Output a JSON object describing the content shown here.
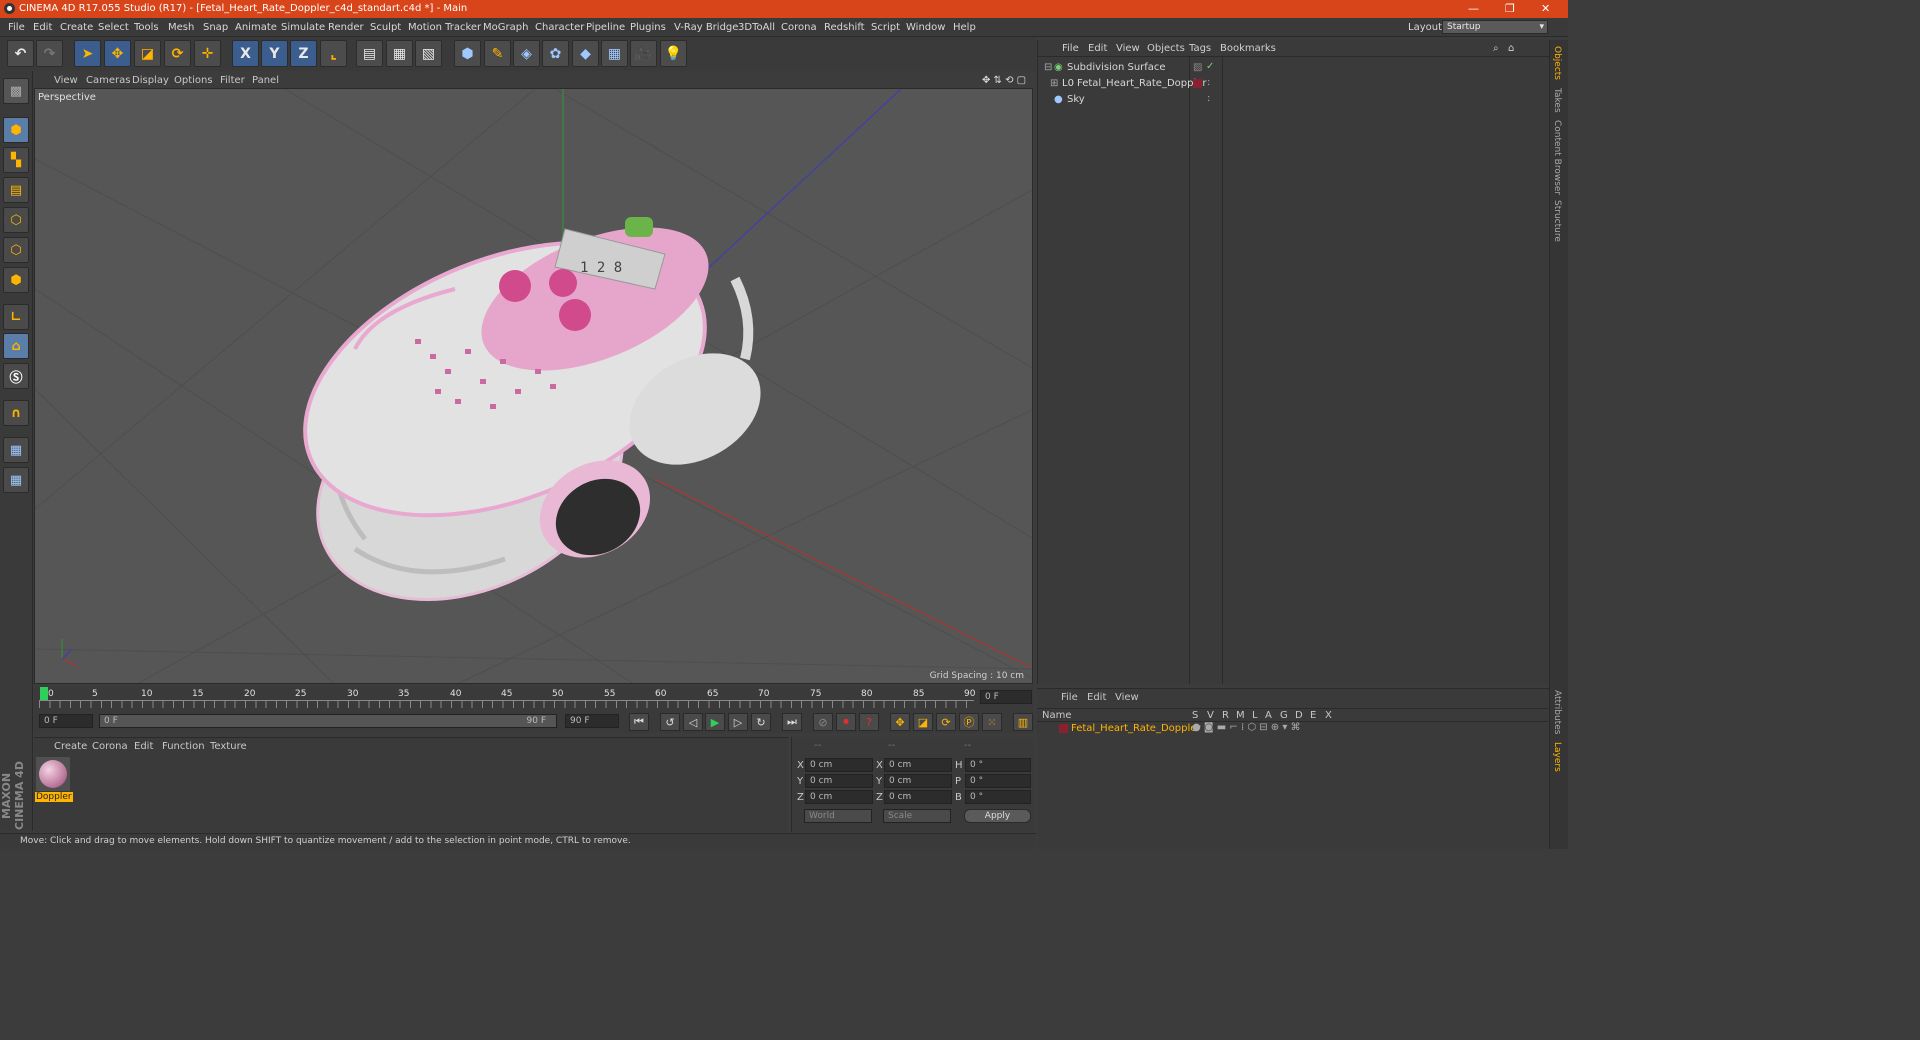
{
  "title": "CINEMA 4D R17.055 Studio (R17) - [Fetal_Heart_Rate_Doppler_c4d_standart.c4d *] - Main",
  "menu": [
    "File",
    "Edit",
    "Create",
    "Select",
    "Tools",
    "Mesh",
    "Snap",
    "Animate",
    "Simulate",
    "Render",
    "Sculpt",
    "Motion Tracker",
    "MoGraph",
    "Character",
    "Pipeline",
    "Plugins",
    "V-Ray Bridge",
    "3DToAll",
    "Corona",
    "Redshift",
    "Script",
    "Window",
    "Help"
  ],
  "layout": {
    "label": "Layout:",
    "value": "Startup"
  },
  "viewport": {
    "menu": [
      "View",
      "Cameras",
      "Display",
      "Options",
      "Filter",
      "Panel"
    ],
    "label": "Perspective",
    "grid_spacing": "Grid Spacing : 10 cm"
  },
  "objects": {
    "menu": [
      "File",
      "Edit",
      "View",
      "Objects",
      "Tags",
      "Bookmarks"
    ],
    "items": [
      "Subdivision Surface",
      "Fetal_Heart_Rate_Doppler",
      "Sky"
    ]
  },
  "side_tabs": [
    "Objects",
    "Takes",
    "Content Browser",
    "Structure",
    "Attributes",
    "Layers"
  ],
  "timeline": {
    "ticks": [
      "0",
      "5",
      "10",
      "15",
      "20",
      "25",
      "30",
      "35",
      "40",
      "45",
      "50",
      "55",
      "60",
      "65",
      "70",
      "75",
      "80",
      "85",
      "90"
    ],
    "end_frame": "0 F",
    "start_field": "0 F",
    "range_left": "0 F",
    "range_right": "90 F",
    "end_field": "90 F"
  },
  "material": {
    "menu": [
      "Create",
      "Corona",
      "Edit",
      "Function",
      "Texture"
    ],
    "name": "Doppler"
  },
  "coords": {
    "headers": [
      "--",
      "--",
      "--"
    ],
    "rows": [
      {
        "a": "X",
        "av": "0 cm",
        "b": "X",
        "bv": "0 cm",
        "c": "H",
        "cv": "0 °"
      },
      {
        "a": "Y",
        "av": "0 cm",
        "b": "Y",
        "bv": "0 cm",
        "c": "P",
        "cv": "0 °"
      },
      {
        "a": "Z",
        "av": "0 cm",
        "b": "Z",
        "bv": "0 cm",
        "c": "B",
        "cv": "0 °"
      }
    ],
    "mode1": "World",
    "mode2": "Scale",
    "apply": "Apply"
  },
  "layers": {
    "menu": [
      "File",
      "Edit",
      "View"
    ],
    "col_name": "Name",
    "cols": [
      "S",
      "V",
      "R",
      "M",
      "L",
      "A",
      "G",
      "D",
      "E",
      "X"
    ],
    "row": "Fetal_Heart_Rate_Doppler"
  },
  "status": "Move: Click and drag to move elements. Hold down SHIFT to quantize movement / add to the selection in point mode, CTRL to remove.",
  "brand": "MAXON CINEMA 4D",
  "colors": {
    "accent": "#d9451a",
    "selection": "#ffb400",
    "object": "#8a2030"
  }
}
